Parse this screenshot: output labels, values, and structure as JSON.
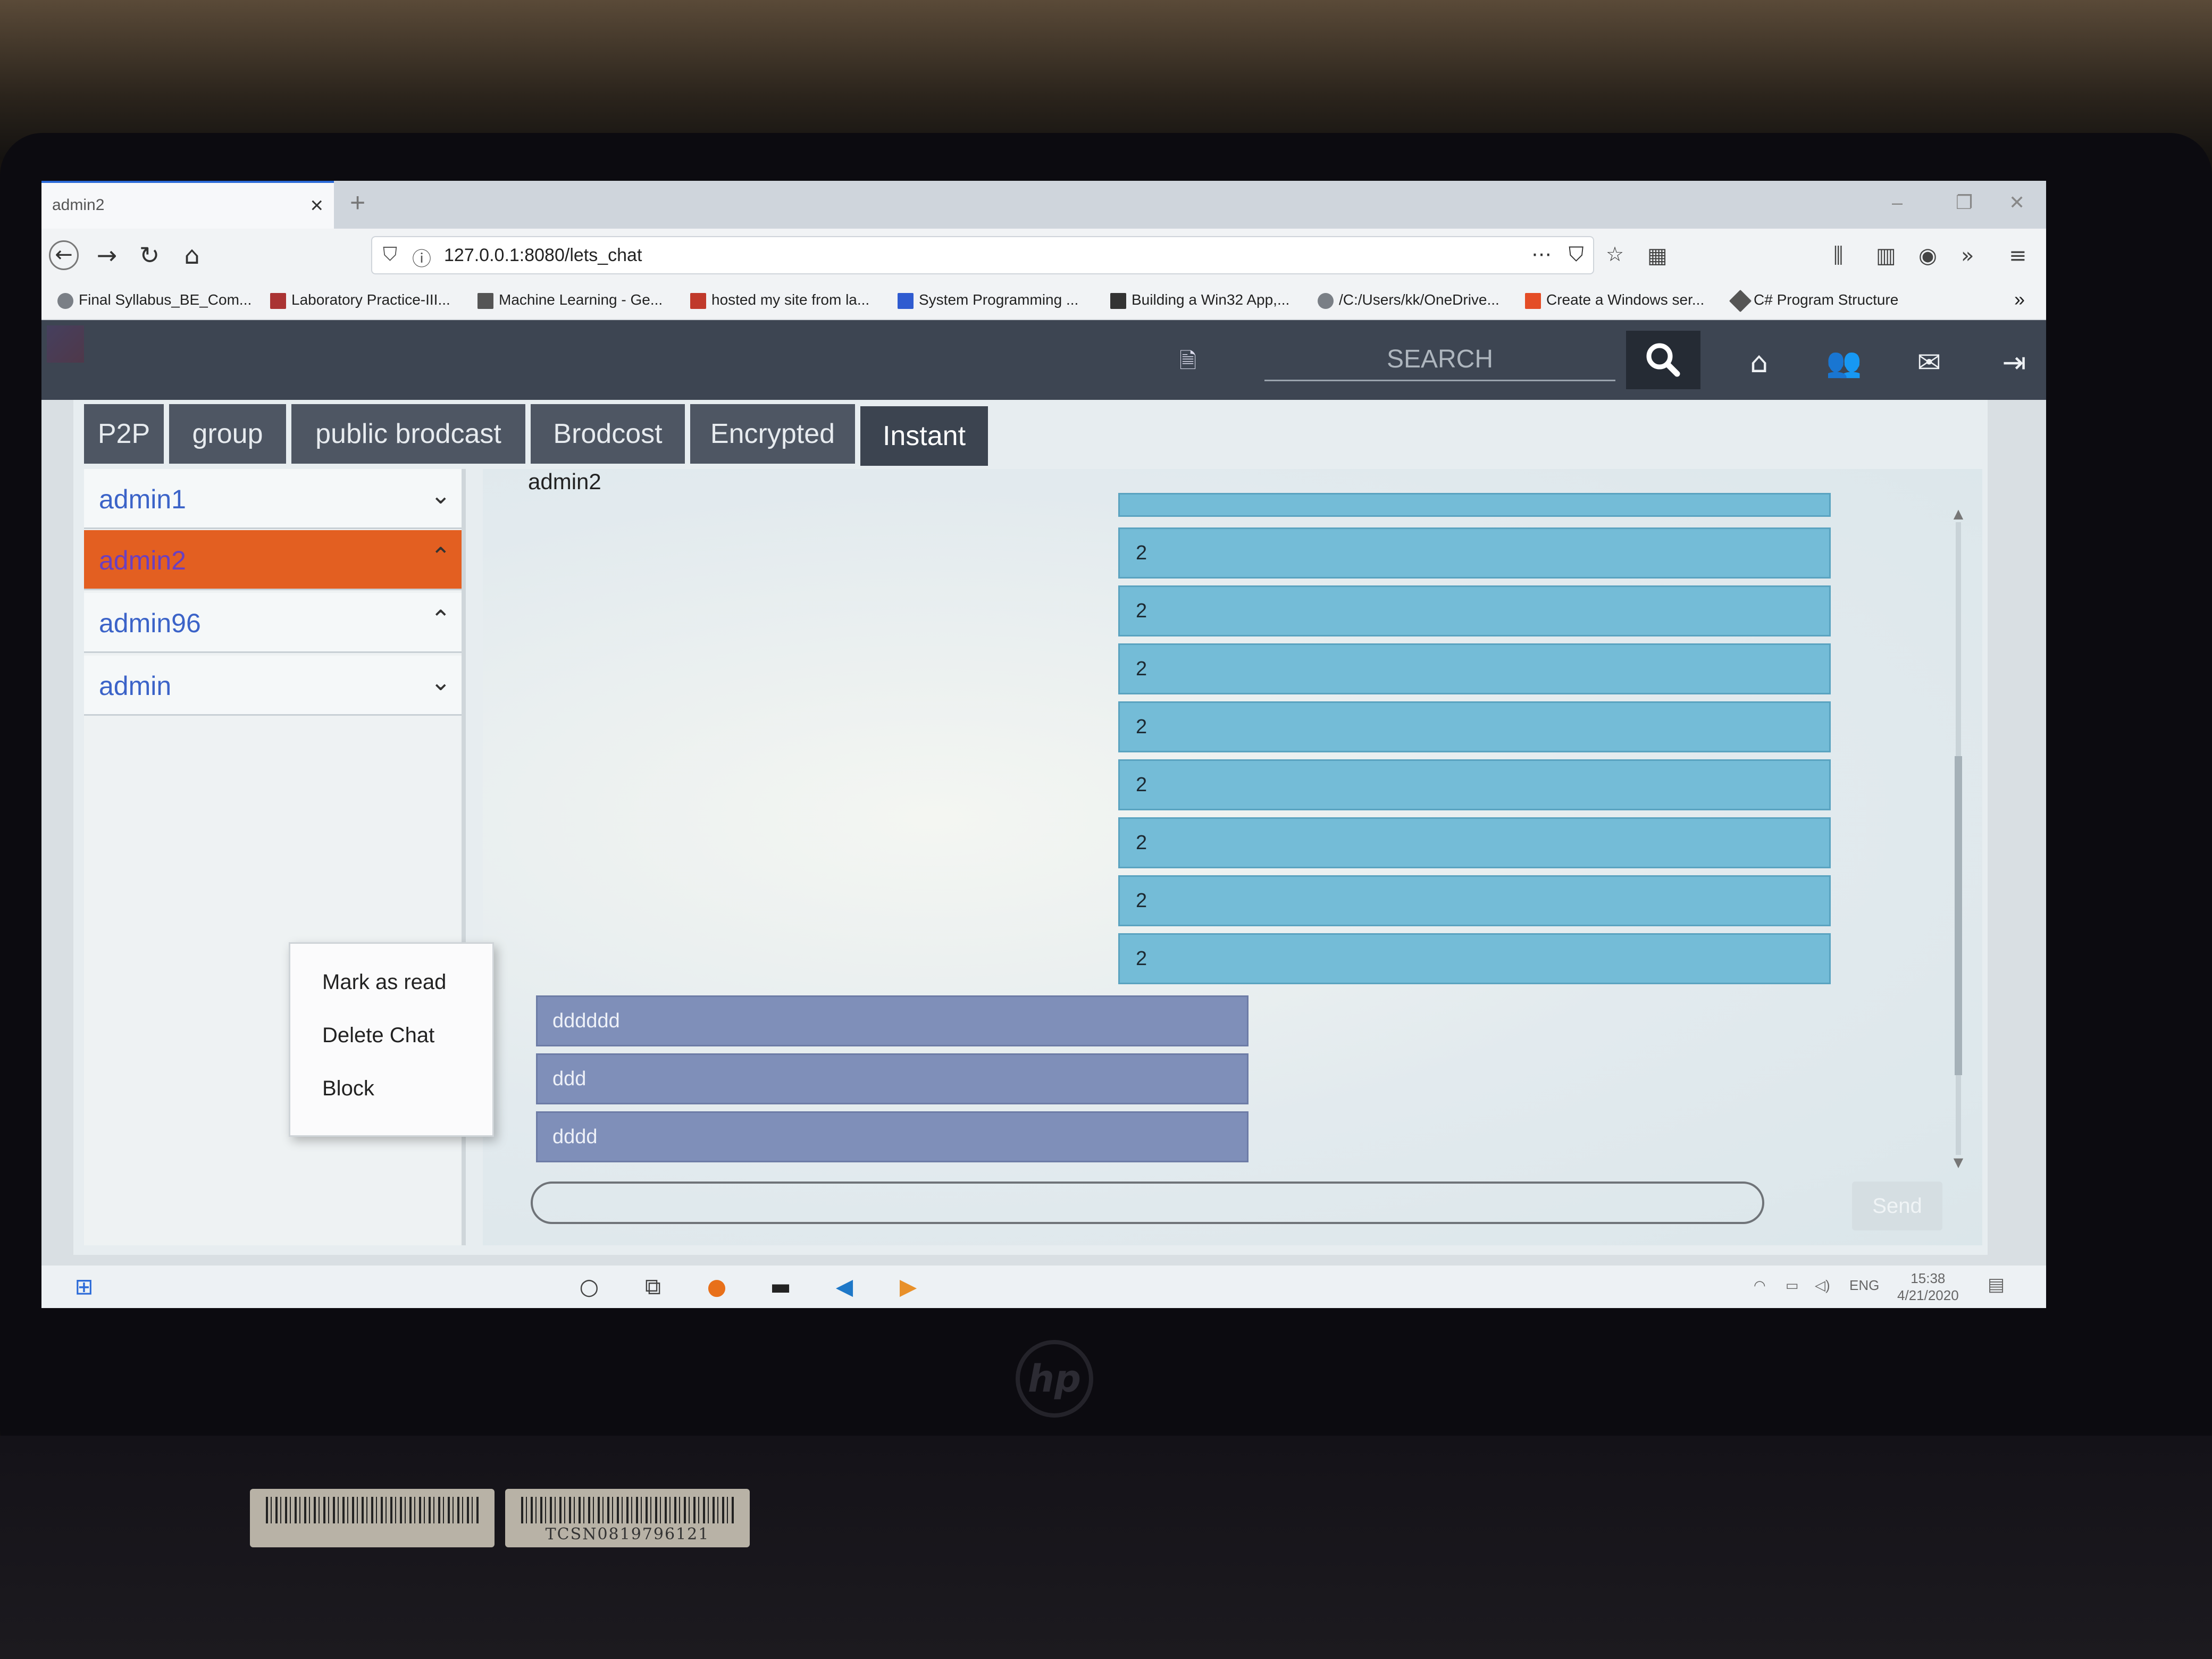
{
  "browser": {
    "tab_title": "admin2",
    "tab_close": "×",
    "new_tab": "+",
    "url": "127.0.0.1:8080/lets_chat",
    "bookmarks": [
      "Final Syllabus_BE_Com...",
      "Laboratory Practice-III...",
      "Machine Learning - Ge...",
      "hosted my site from la...",
      "System Programming ...",
      "Building a Win32 App,...",
      "/C:/Users/kk/OneDrive...",
      "Create a Windows ser...",
      "C# Program Structure"
    ],
    "bookmarks_overflow": "»"
  },
  "appbar": {
    "search_placeholder": "SEARCH",
    "icons": [
      "document-icon",
      "search-icon",
      "home-icon",
      "users-icon",
      "mail-icon",
      "logout-icon"
    ]
  },
  "tabs": [
    "P2P",
    "group",
    "public brodcast",
    "Brodcost",
    "Encrypted",
    "Instant"
  ],
  "contacts": [
    {
      "name": "admin1",
      "chevron": "⌄"
    },
    {
      "name": "admin2",
      "chevron": "⌃"
    },
    {
      "name": "admin96",
      "chevron": "⌃"
    },
    {
      "name": "admin",
      "chevron": "⌄"
    }
  ],
  "context_menu": [
    "Mark as read",
    "Delete Chat",
    "Block"
  ],
  "chat": {
    "title": "admin2",
    "incoming": [
      "2",
      "2",
      "2",
      "2",
      "2",
      "2",
      "2",
      "2",
      "2"
    ],
    "outgoing": [
      "dddddd",
      "ddd",
      "dddd"
    ],
    "send_label": "Send"
  },
  "taskbar": {
    "lang": "ENG",
    "time": "15:38",
    "date": "4/21/2020"
  },
  "colors": {
    "active_contact": "#e35f21",
    "incoming_bubble": "#74bcd7",
    "outgoing_bubble": "#7f8fb9",
    "appbar": "#3d4552"
  }
}
